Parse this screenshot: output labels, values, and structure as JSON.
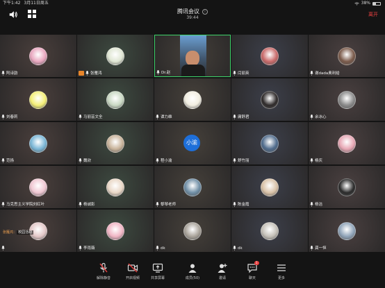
{
  "status_bar": {
    "time": "下午1:42",
    "date": "3月11日周五",
    "battery": "38%",
    "battery_level": 0.38
  },
  "meeting": {
    "title": "腾讯会议",
    "timer": "39:44",
    "leave_label": "离开"
  },
  "colors": {
    "leave": "#e84040",
    "speaking_border": "#3ed46a",
    "text_avatar": "#1e6fd9",
    "host_badge": "#e8852a"
  },
  "participants": [
    {
      "name": "阿诗韵",
      "avatar": "#e9a7bf"
    },
    {
      "name": "张雁鸿",
      "avatar": "#dfe6d3",
      "host": true
    },
    {
      "name": "Dr.赵",
      "video": true,
      "speaking": true
    },
    {
      "name": "闫丽英",
      "avatar": "#c96a6a"
    },
    {
      "name": "谢dada奥利给",
      "avatar": "#7a5a4a"
    },
    {
      "name": "刘春莉",
      "avatar": "#f4ef77"
    },
    {
      "name": "马丽芸文全",
      "avatar": "#c9d8c3"
    },
    {
      "name": "谭力维",
      "avatar": "#f1ede0"
    },
    {
      "name": "庸舒君",
      "avatar": "#2e2a2a"
    },
    {
      "name": "余冰心",
      "avatar": "#8a8a8a"
    },
    {
      "name": "范扬",
      "avatar": "#7ab6d6"
    },
    {
      "name": "魏欣",
      "avatar": "#c8b39a"
    },
    {
      "name": "程小渝",
      "text_avatar": "小渝"
    },
    {
      "name": "舒竹丽",
      "avatar": "#4f6b8c"
    },
    {
      "name": "杨庆",
      "avatar": "#e7a7b4"
    },
    {
      "name": "马克思主义学院刘红叶",
      "avatar": "#f0c7d2"
    },
    {
      "name": "杨诚影",
      "avatar": "#e9d7c6"
    },
    {
      "name": "黎琴老师",
      "avatar": "#6f8ea5"
    },
    {
      "name": "陈金霞",
      "avatar": "#d9c2a8"
    },
    {
      "name": "杨洁",
      "avatar": "#2a2a2a"
    },
    {
      "name": "",
      "avatar": "#e3c7c7",
      "chat": {
        "sender": "张雁鸿：",
        "text": "校园活动"
      }
    },
    {
      "name": "李雨薇",
      "avatar": "#f0b5c4"
    },
    {
      "name": "dk",
      "avatar": "#a9a39a"
    },
    {
      "name": "dk",
      "avatar": "#c4c0b8"
    },
    {
      "name": "龚一恒",
      "avatar": "#8fa3b8"
    }
  ],
  "toolbar": [
    {
      "id": "mute",
      "label": "解除静音",
      "icon": "mic-muted-icon"
    },
    {
      "id": "video",
      "label": "开启视频",
      "icon": "camera-off-icon"
    },
    {
      "id": "share",
      "label": "共享屏幕",
      "icon": "share-screen-icon"
    },
    {
      "id": "members",
      "label": "成员(50)",
      "icon": "members-icon"
    },
    {
      "id": "invite",
      "label": "邀请",
      "icon": "invite-icon"
    },
    {
      "id": "chat",
      "label": "聊天",
      "icon": "chat-icon",
      "badge": "1"
    },
    {
      "id": "more",
      "label": "更多",
      "icon": "more-icon"
    }
  ]
}
